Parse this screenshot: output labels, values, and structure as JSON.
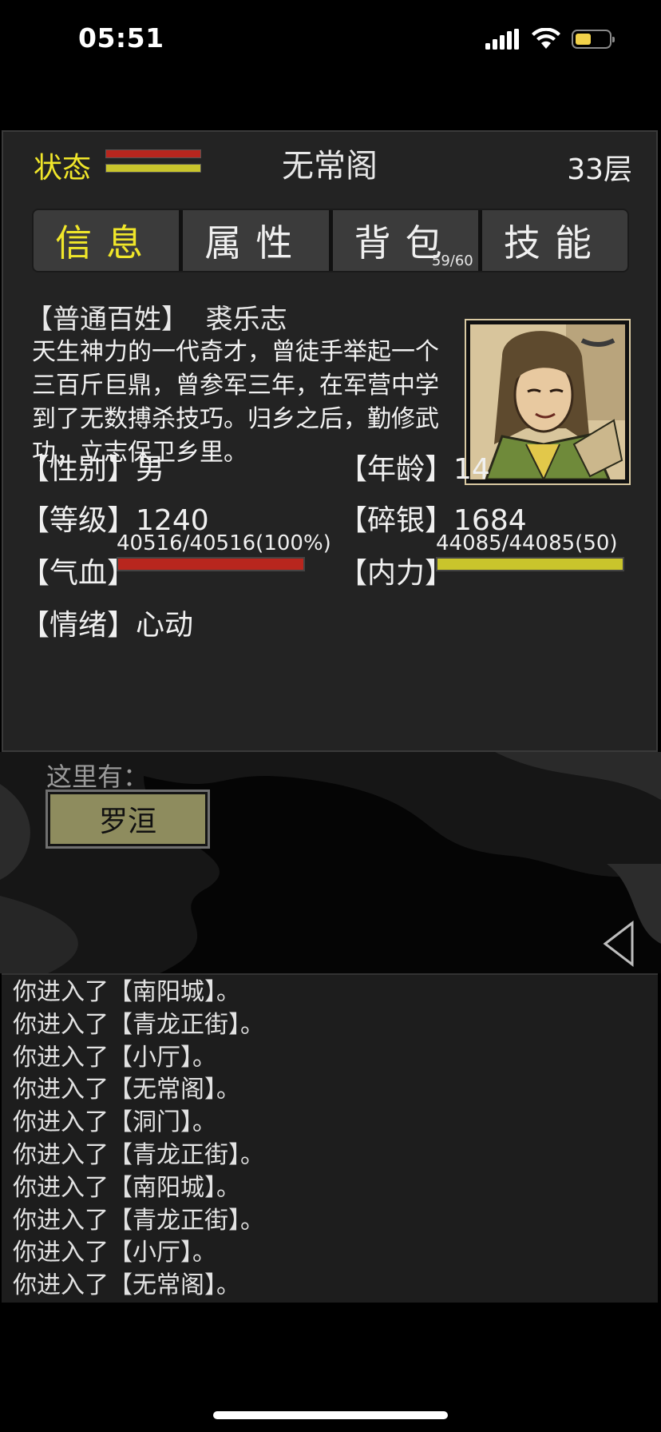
{
  "status_bar": {
    "time": "05:51",
    "battery_level": 0.45
  },
  "header": {
    "status_label": "状态",
    "location": "无常阁",
    "floor": "33层"
  },
  "tabs": [
    {
      "label": "信息",
      "active": true
    },
    {
      "label": "属性",
      "active": false
    },
    {
      "label": "背包",
      "active": false,
      "count": "59/60"
    },
    {
      "label": "技能",
      "active": false
    }
  ],
  "character": {
    "title": "【普通百姓】",
    "name": "裘乐志",
    "description": "天生神力的一代奇才，曾徒手举起一个三百斤巨鼎，曾参军三年，在军营中学到了无数搏杀技巧。归乡之后，勤修武功，立志保卫乡里。",
    "gender_label": "【性别】",
    "gender": "男",
    "age_label": "【年龄】",
    "age": "14",
    "level_label": "【等级】",
    "level": "1240",
    "silver_label": "【碎银】",
    "silver": "1684",
    "hp_label": "【气血】",
    "hp_text": "40516/40516(100%)",
    "hp_fraction": 1.0,
    "mp_label": "【内力】",
    "mp_text": "44085/44085(50)",
    "mp_fraction": 1.0,
    "mood_label": "【情绪】",
    "mood": "心动"
  },
  "scene": {
    "here_label": "这里有：",
    "npcs": [
      "罗洹"
    ]
  },
  "log": [
    "你进入了【南阳城】。",
    "你进入了【青龙正街】。",
    "你进入了【小厅】。",
    "你进入了【无常阁】。",
    "你进入了【洞门】。",
    "你进入了【青龙正街】。",
    "你进入了【南阳城】。",
    "你进入了【青龙正街】。",
    "你进入了【小厅】。",
    "你进入了【无常阁】。"
  ],
  "colors": {
    "accent_yellow": "#f0e62a",
    "hp_red": "#b8261e",
    "mp_yellow": "#c9c52c",
    "npc_button": "#8e8c5e"
  }
}
